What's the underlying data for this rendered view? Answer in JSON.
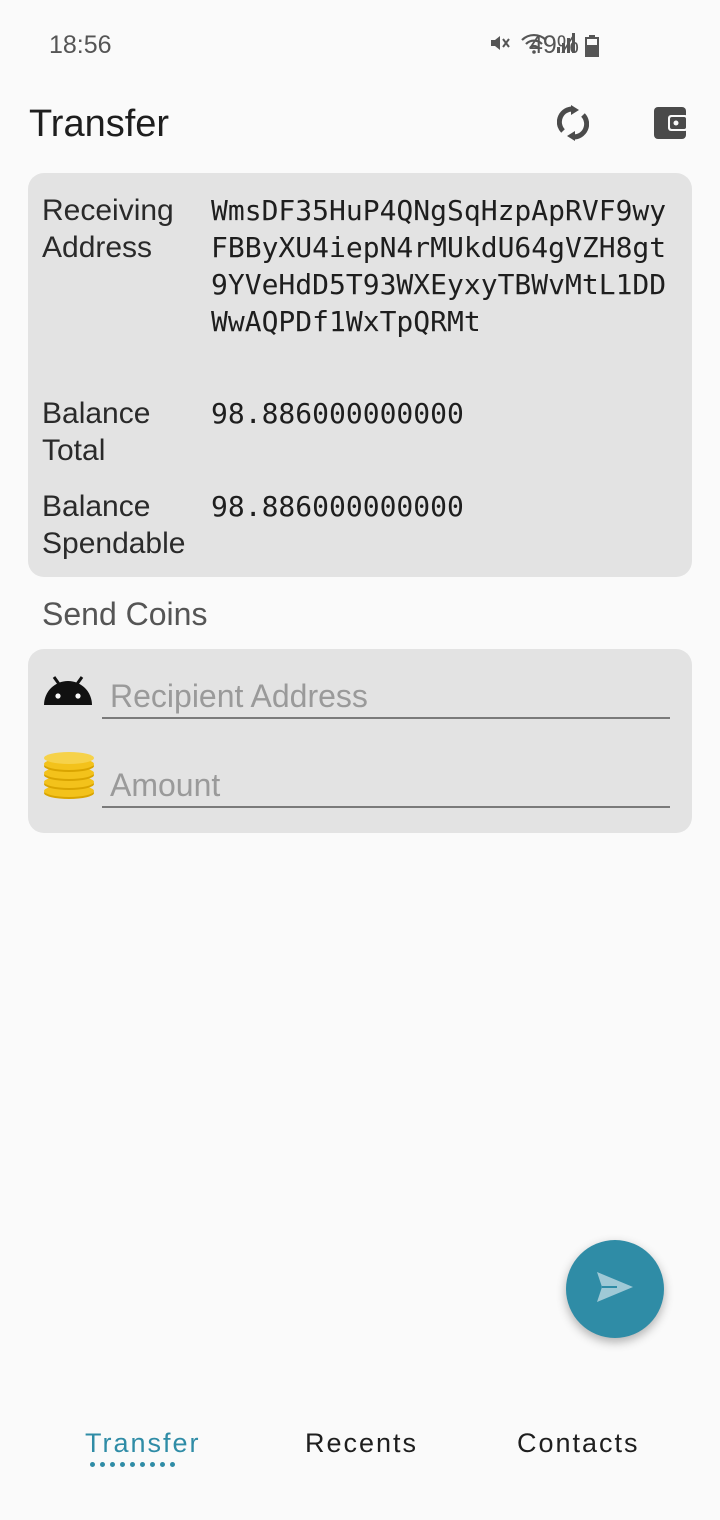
{
  "status_bar": {
    "time": "18:56",
    "battery": "49%",
    "icons": [
      "mute-icon",
      "wifi-icon",
      "signal-icon",
      "battery-icon"
    ]
  },
  "app_bar": {
    "title": "Transfer",
    "actions": [
      "sync-icon",
      "wallet-icon"
    ]
  },
  "account": {
    "receiving_address_label": "Receiving Address",
    "receiving_address": "WmsDF35HuP4QNgSqHzpApRVF9wyFBByXU4iepN4rMUkdU64gVZH8gt9YVeHdD5T93WXEyxyTBWvMtL1DDWwAQPDf1WxTpQRMt",
    "balance_total_label": "Balance Total",
    "balance_total": "98.886000000000",
    "balance_spendable_label": "Balance Spendable",
    "balance_spendable": "98.886000000000"
  },
  "send": {
    "section_title": "Send Coins",
    "recipient_placeholder": "Recipient Address",
    "recipient_value": "",
    "amount_placeholder": "Amount",
    "amount_value": ""
  },
  "fab": {
    "icon": "send-icon"
  },
  "bottom_nav": {
    "tabs": [
      {
        "label": "Transfer",
        "active": true
      },
      {
        "label": "Recents",
        "active": false
      },
      {
        "label": "Contacts",
        "active": false
      }
    ]
  },
  "colors": {
    "accent": "#2f8ca6",
    "card_bg": "#e3e3e3",
    "page_bg": "#fafafa"
  }
}
